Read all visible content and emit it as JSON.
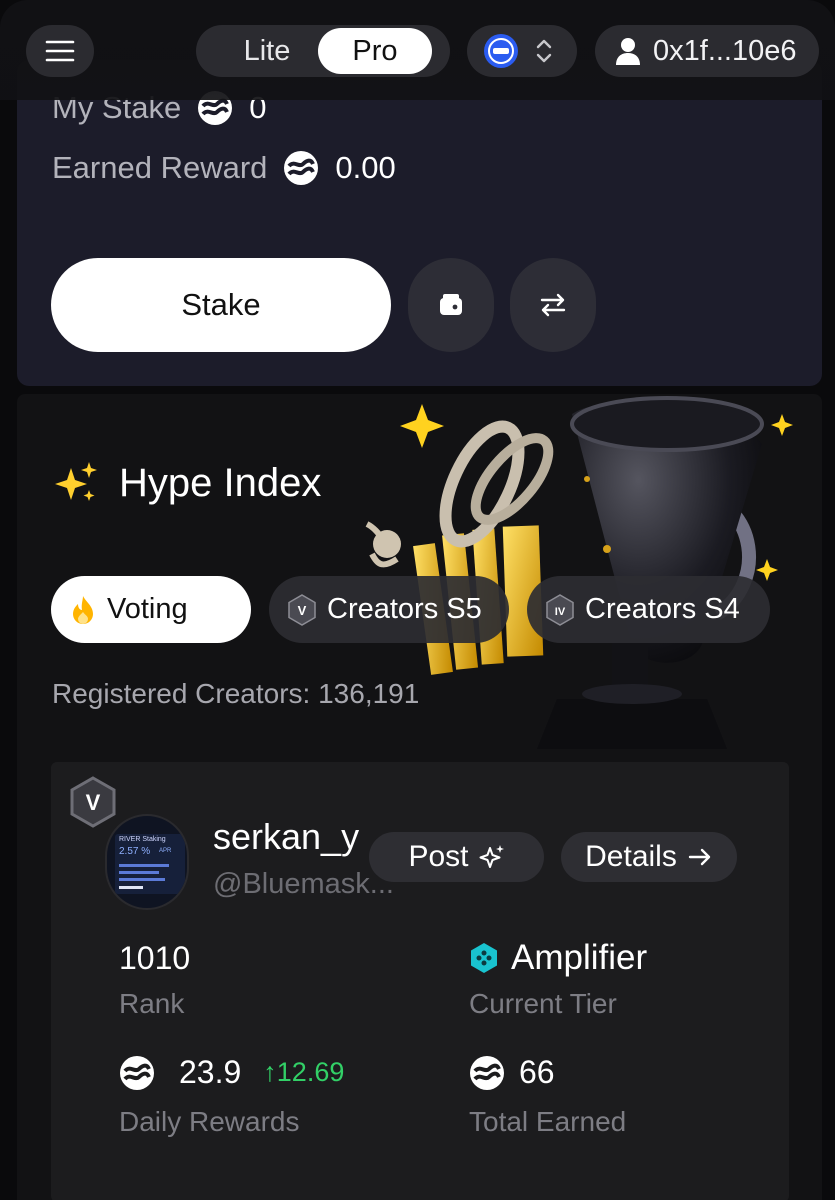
{
  "header": {
    "mode_options": [
      "Lite",
      "Pro"
    ],
    "active_mode": "Pro",
    "account_address": "0x1f...10e6"
  },
  "stake_card": {
    "my_stake_label": "My Stake",
    "my_stake_value": "0",
    "earned_reward_label": "Earned Reward",
    "earned_reward_value": "0.00",
    "stake_button": "Stake"
  },
  "hype": {
    "title": "Hype Index",
    "tabs": [
      {
        "label": "Voting",
        "active": true
      },
      {
        "label": "Creators S5",
        "badge": "V"
      },
      {
        "label": "Creators S4",
        "badge": "IV"
      }
    ],
    "registered_creators": "Registered Creators: 136,191"
  },
  "creator": {
    "tier_badge": "V",
    "avatar_text": {
      "title": "RIVER Staking",
      "apr": "2.57 %",
      "apr_unit": "APR"
    },
    "name": "serkan_y",
    "handle": "@Bluemask...",
    "post_button": "Post",
    "details_button": "Details",
    "rank_value": "1010",
    "rank_label": "Rank",
    "tier_value": "Amplifier",
    "tier_label": "Current Tier",
    "daily_rewards_value": "23.9",
    "daily_rewards_change": "↑12.69",
    "daily_rewards_label": "Daily Rewards",
    "total_earned_value": "66",
    "total_earned_label": "Total Earned"
  },
  "colors": {
    "accent_up": "#32d067",
    "tier_icon": "#19c3cf",
    "network": "#2b5cf0",
    "card_bg": "#1c1c2a"
  }
}
